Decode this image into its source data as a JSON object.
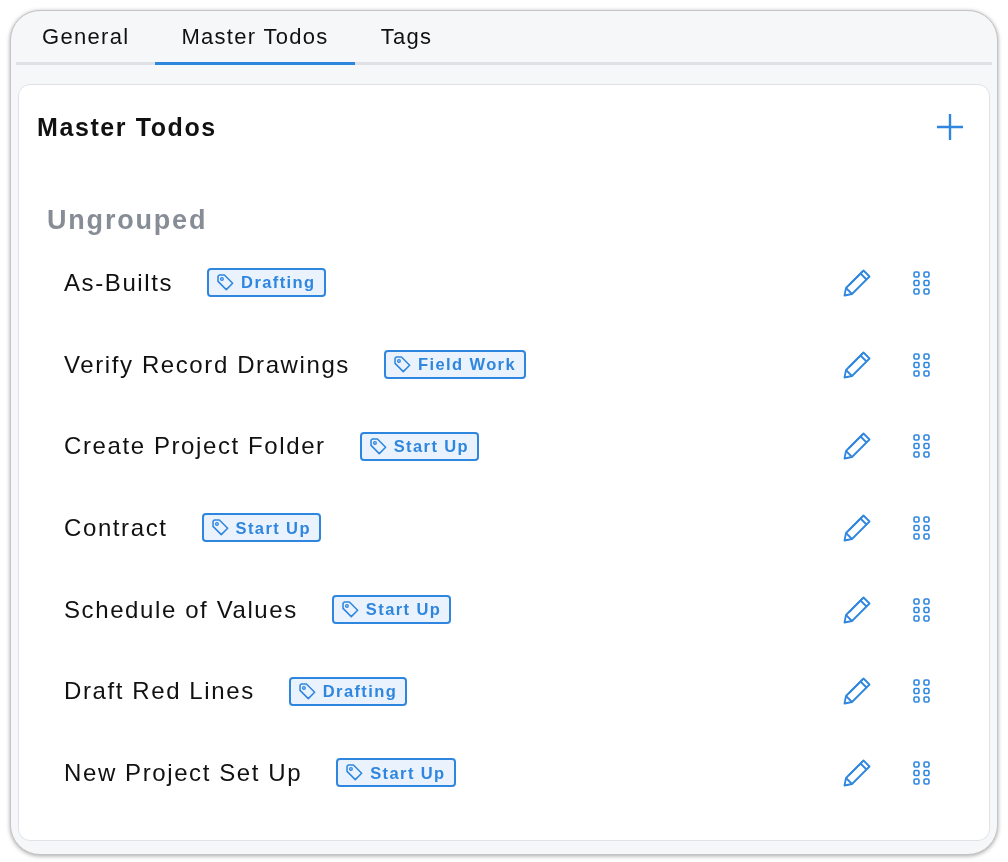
{
  "tabs": [
    {
      "label": "General",
      "selected": false
    },
    {
      "label": "Master Todos",
      "selected": true
    },
    {
      "label": "Tags",
      "selected": false
    }
  ],
  "panel": {
    "title": "Master Todos",
    "groups": [
      {
        "title": "Ungrouped",
        "todos": [
          {
            "name": "As-Builts",
            "tag": "Drafting"
          },
          {
            "name": "Verify Record Drawings",
            "tag": "Field Work"
          },
          {
            "name": "Create Project Folder",
            "tag": "Start Up"
          },
          {
            "name": "Contract",
            "tag": "Start Up"
          },
          {
            "name": "Schedule of Values",
            "tag": "Start Up"
          },
          {
            "name": "Draft Red Lines",
            "tag": "Drafting"
          },
          {
            "name": "New Project Set Up",
            "tag": "Start Up"
          }
        ]
      }
    ]
  }
}
